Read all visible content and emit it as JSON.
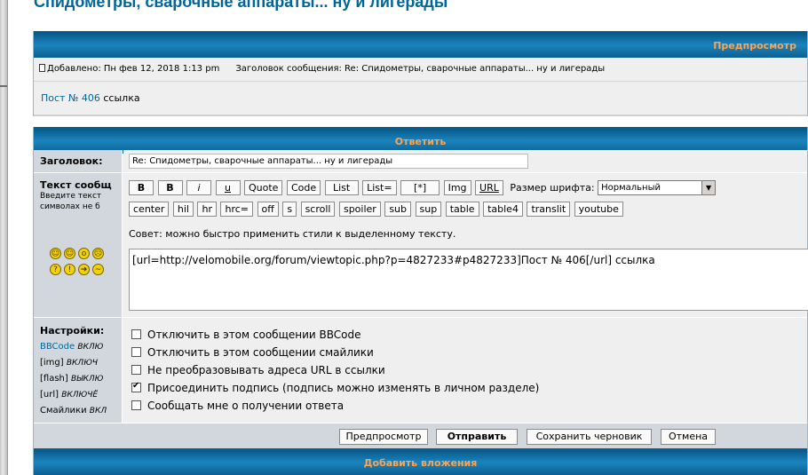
{
  "page_title": "Спидометры, сварочные аппараты... ну и лигерады",
  "preview": {
    "header": "Предпросмотр",
    "posted_label": "Добавлено: Пн фев 12, 2018 1:13 pm",
    "subject_label": "Заголовок сообщения: Re: Спидометры, сварочные аппараты... ну и лигерады",
    "body_link": "Пост № 406",
    "body_text": " ссылка"
  },
  "reply": {
    "header": "Ответить",
    "subject_label": "Заголовок:",
    "subject_value": "Re: Спидометры, сварочные аппараты... ну и лигерады",
    "text_label": "Текст сообщ",
    "text_hint_1": "Введите текст",
    "text_hint_2": "символах не б",
    "toolbar_row1": [
      "B",
      "B",
      "i",
      "u",
      "Quote",
      "Code",
      "List",
      "List=",
      "[*]",
      "Img",
      "URL"
    ],
    "font_size_label": "Размер шрифта:",
    "font_size_value": "Нормальный",
    "toolbar_row2": [
      "center",
      "hil",
      "hr",
      "hrc=",
      "off",
      "s",
      "scroll",
      "spoiler",
      "sub",
      "sup",
      "table",
      "table4",
      "translit",
      "youtube"
    ],
    "tip": "Совет: можно быстро применить стили к выделенному тексту.",
    "message_value": "[url=http://velomobile.org/forum/viewtopic.php?p=4827233#p4827233]Пост № 406[/url] ссылка",
    "settings_label": "Настройки:",
    "settings_info": [
      {
        "key": "BBCode",
        "state": "ВКЛЮ"
      },
      {
        "key": "[img]",
        "state": "ВКЛЮЧ"
      },
      {
        "key": "[flash]",
        "state": "ВЫКЛЮ"
      },
      {
        "key": "[url]",
        "state": "ВКЛЮЧЁ"
      },
      {
        "key": "Смайлики",
        "state": "ВКЛ"
      }
    ],
    "options": [
      {
        "label": "Отключить в этом сообщении BBCode",
        "checked": false
      },
      {
        "label": "Отключить в этом сообщении смайлики",
        "checked": false
      },
      {
        "label": "Не преобразовывать адреса URL в ссылки",
        "checked": false
      },
      {
        "label": "Присоединить подпись (подпись можно изменять в личном разделе)",
        "checked": true
      },
      {
        "label": "Сообщать мне о получении ответа",
        "checked": false
      }
    ],
    "buttons": {
      "preview": "Предпросмотр",
      "submit": "Отправить",
      "save_draft": "Сохранить черновик",
      "cancel": "Отмена"
    }
  },
  "attachments": {
    "header": "Добавить вложения"
  },
  "colors": {
    "accent_header": "#ffa34f",
    "link": "#006699",
    "header_bg": "#1b84bd"
  }
}
